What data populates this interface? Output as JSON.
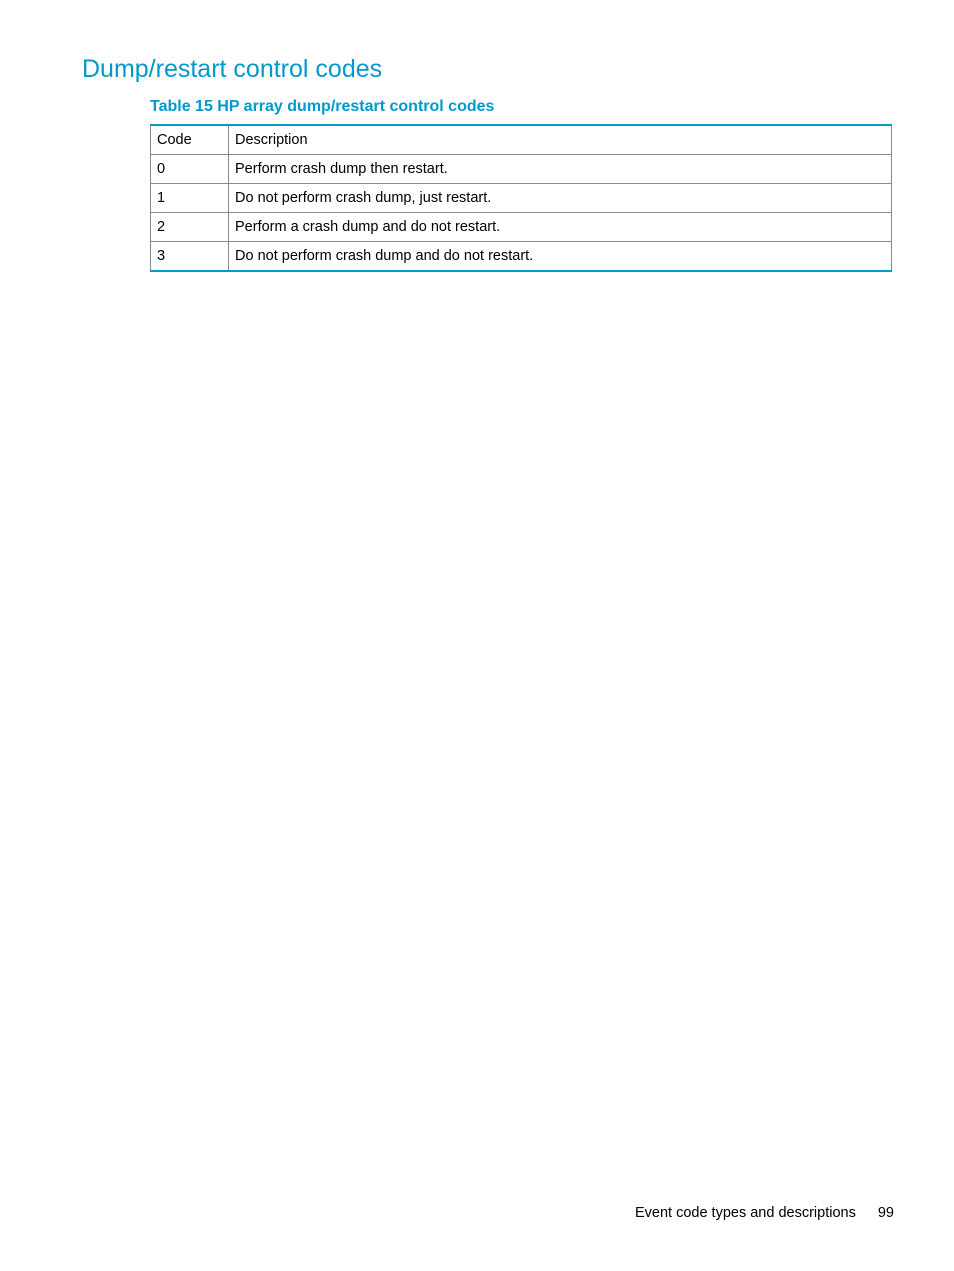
{
  "heading": "Dump/restart control codes",
  "table": {
    "caption": "Table 15 HP array dump/restart control codes",
    "headers": {
      "code": "Code",
      "description": "Description"
    },
    "rows": [
      {
        "code": "0",
        "description": "Perform crash dump then restart."
      },
      {
        "code": "1",
        "description": "Do not perform crash dump, just restart."
      },
      {
        "code": "2",
        "description": "Perform a crash dump and do not restart."
      },
      {
        "code": "3",
        "description": "Do not perform crash dump and do not restart."
      }
    ]
  },
  "footer": {
    "section": "Event code types and descriptions",
    "page": "99"
  }
}
